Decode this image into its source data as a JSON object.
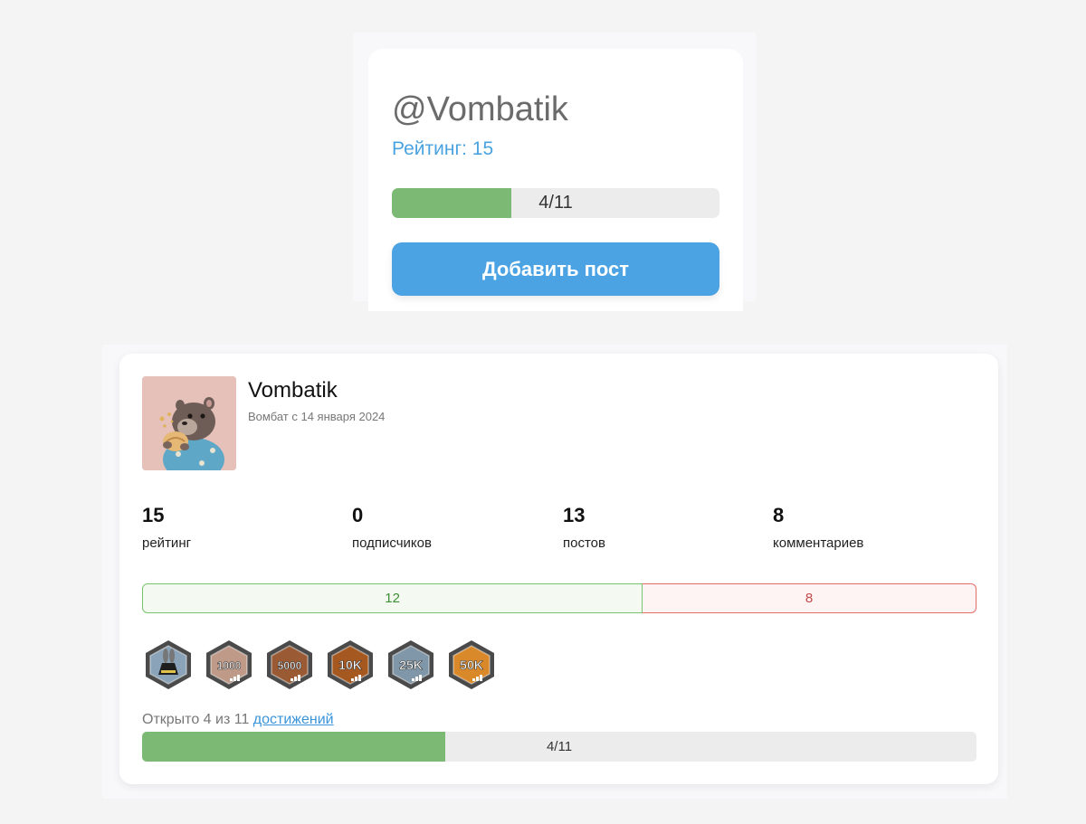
{
  "mini_card": {
    "username": "@Vombatik",
    "rating_text": "Рейтинг: 15",
    "progress_text": "4/11",
    "progress_fraction": 0.3636,
    "add_post_label": "Добавить пост"
  },
  "profile": {
    "name": "Vombatik",
    "since": "Вомбат с 14 января 2024",
    "stats": [
      {
        "value": "15",
        "label": "рейтинг"
      },
      {
        "value": "0",
        "label": "подписчиков"
      },
      {
        "value": "13",
        "label": "постов"
      },
      {
        "value": "8",
        "label": "комментариев"
      }
    ],
    "votes": {
      "positive": "12",
      "negative": "8",
      "positive_share": 0.6
    },
    "badges": [
      {
        "icon": "magic-hat-badge-icon",
        "label": "",
        "color": "#8aa3b8"
      },
      {
        "icon": "1000-badge-icon",
        "label": "1000",
        "color": "#c09a88"
      },
      {
        "icon": "5000-badge-icon",
        "label": "5000",
        "color": "#9a5a34"
      },
      {
        "icon": "10k-badge-icon",
        "label": "10K",
        "color": "#a5581f"
      },
      {
        "icon": "25k-badge-icon",
        "label": "25K",
        "color": "#7f97a8"
      },
      {
        "icon": "50k-badge-icon",
        "label": "50K",
        "color": "#d9892a"
      }
    ],
    "achievements_prefix": "Открыто 4 из 11 ",
    "achievements_link": "достижений",
    "progress_text": "4/11",
    "progress_fraction": 0.3636
  },
  "colors": {
    "accent_blue": "#4ba3e3",
    "progress_green": "#7bb974",
    "positive_green": "#3d8f33",
    "negative_red": "#c44a4a"
  }
}
